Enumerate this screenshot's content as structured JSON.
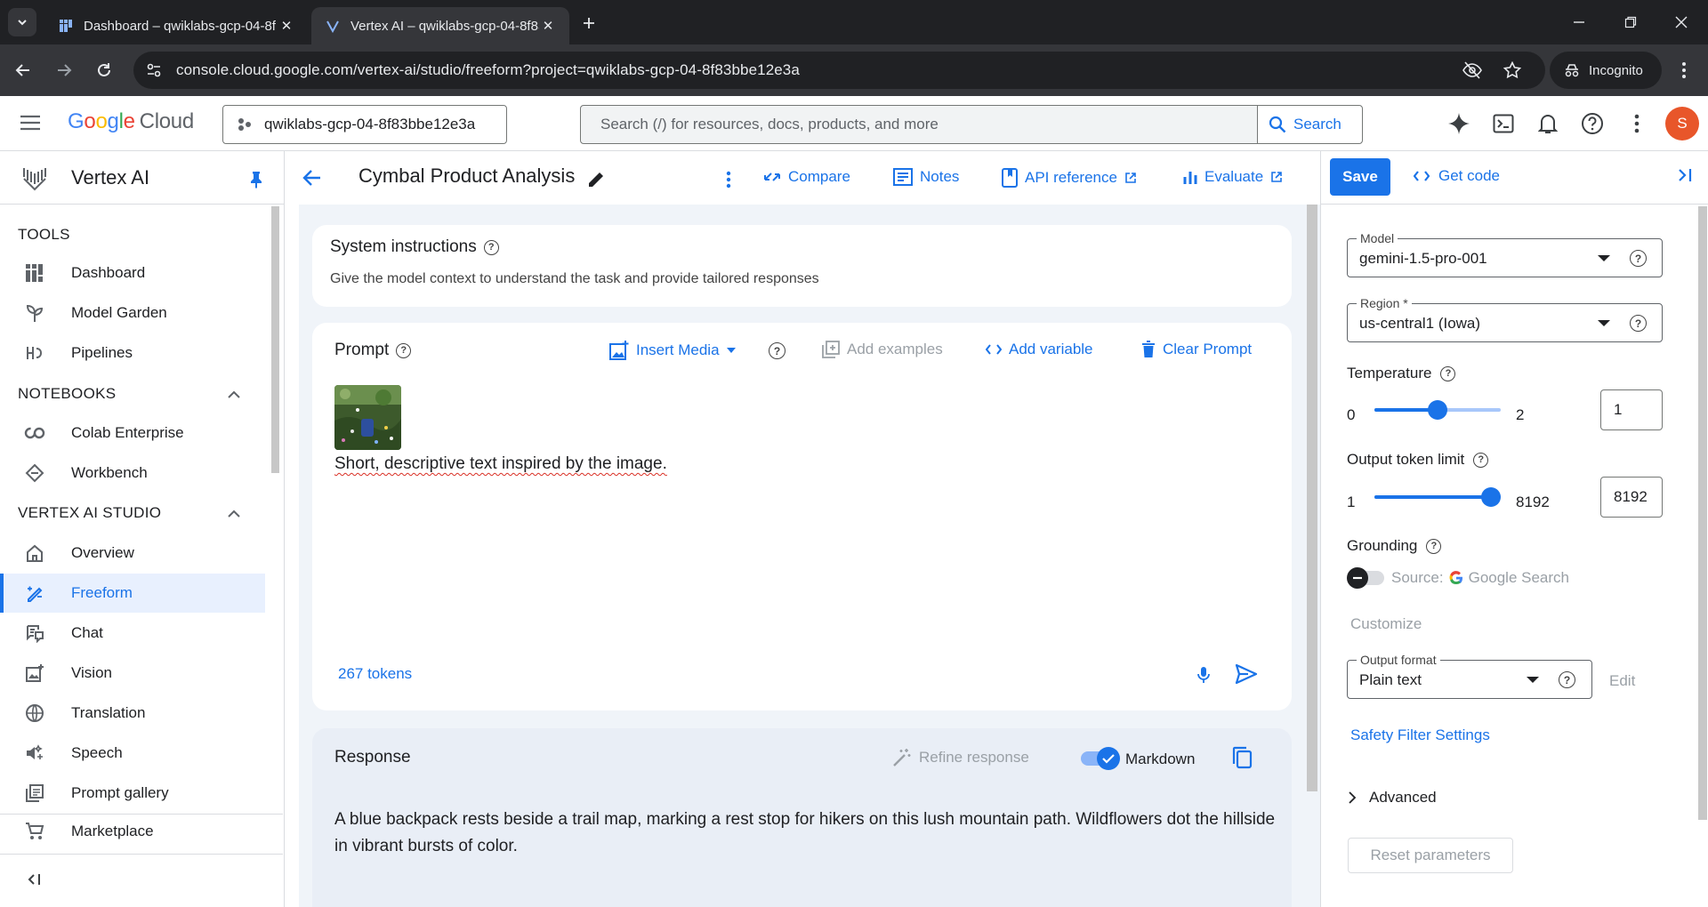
{
  "browser": {
    "tabs": [
      {
        "title": "Dashboard – qwiklabs-gcp-04-8f",
        "active": false
      },
      {
        "title": "Vertex AI – qwiklabs-gcp-04-8f83",
        "active": true
      }
    ],
    "url": "console.cloud.google.com/vertex-ai/studio/freeform?project=qwiklabs-gcp-04-8f83bbe12e3a",
    "incognito_label": "Incognito"
  },
  "header": {
    "logo_google": "Google",
    "logo_cloud": "Cloud",
    "project": "qwiklabs-gcp-04-8f83bbe12e3a",
    "search_placeholder": "Search (/) for resources, docs, products, and more",
    "search_button": "Search",
    "avatar_letter": "S"
  },
  "sidebar": {
    "product_name": "Vertex AI",
    "sections": [
      {
        "title": "TOOLS",
        "items": [
          {
            "label": "Dashboard",
            "icon": "dashboard-icon"
          },
          {
            "label": "Model Garden",
            "icon": "model-garden-icon"
          },
          {
            "label": "Pipelines",
            "icon": "pipelines-icon"
          }
        ]
      },
      {
        "title": "NOTEBOOKS",
        "items": [
          {
            "label": "Colab Enterprise",
            "icon": "colab-icon"
          },
          {
            "label": "Workbench",
            "icon": "workbench-icon"
          }
        ]
      },
      {
        "title": "VERTEX AI STUDIO",
        "items": [
          {
            "label": "Overview",
            "icon": "home-icon"
          },
          {
            "label": "Freeform",
            "icon": "freeform-icon",
            "active": true
          },
          {
            "label": "Chat",
            "icon": "chat-icon"
          },
          {
            "label": "Vision",
            "icon": "vision-icon"
          },
          {
            "label": "Translation",
            "icon": "translation-icon"
          },
          {
            "label": "Speech",
            "icon": "speech-icon"
          },
          {
            "label": "Prompt gallery",
            "icon": "prompt-gallery-icon"
          }
        ]
      }
    ],
    "bottom_item": {
      "label": "Marketplace",
      "icon": "cart-icon"
    }
  },
  "toolbar": {
    "title": "Cymbal Product Analysis",
    "compare": "Compare",
    "notes": "Notes",
    "api_reference": "API reference",
    "evaluate": "Evaluate"
  },
  "system_instructions": {
    "title": "System instructions",
    "placeholder": "Give the model context to understand the task and provide tailored responses"
  },
  "prompt": {
    "title": "Prompt",
    "insert_media": "Insert Media",
    "add_examples": "Add examples",
    "add_variable": "Add variable",
    "clear_prompt": "Clear Prompt",
    "text": "Short, descriptive text inspired by the image.",
    "token_count": "267 tokens"
  },
  "response": {
    "title": "Response",
    "refine": "Refine response",
    "markdown_label": "Markdown",
    "markdown_enabled": true,
    "text": "A blue backpack rests beside a trail map, marking a rest stop for hikers on this lush mountain path. Wildflowers dot the hillside in vibrant bursts of color."
  },
  "settings": {
    "save": "Save",
    "get_code": "Get code",
    "model_label": "Model",
    "model_value": "gemini-1.5-pro-001",
    "region_label": "Region *",
    "region_value": "us-central1 (Iowa)",
    "temperature_label": "Temperature",
    "temperature_min": "0",
    "temperature_max": "2",
    "temperature_value": "1",
    "temperature_fraction": 0.5,
    "token_label": "Output token limit",
    "token_min": "1",
    "token_max": "8192",
    "token_value": "8192",
    "token_fraction": 1.0,
    "grounding_label": "Grounding",
    "grounding_source_prefix": "Source:",
    "grounding_source": "Google Search",
    "customize_label": "Customize",
    "output_format_label": "Output format",
    "output_format_value": "Plain text",
    "edit_label": "Edit",
    "safety_link": "Safety Filter Settings",
    "advanced_label": "Advanced",
    "reset_label": "Reset parameters"
  },
  "colors": {
    "accent": "#1a73e8",
    "active_nav_bg": "#e8f0fe",
    "avatar": "#e8562a"
  }
}
